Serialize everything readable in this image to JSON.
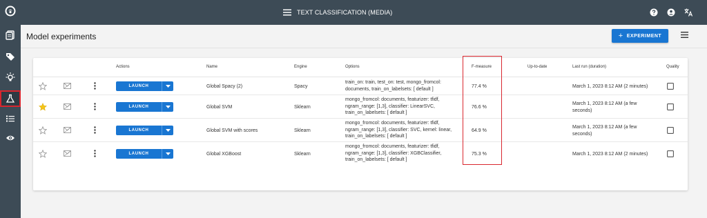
{
  "app": {
    "title": "TEXT CLASSIFICATION (MEDIA)",
    "colors": {
      "chrome": "#3d4b56",
      "accent": "#1976d2",
      "highlight": "#d9262e",
      "star": "#f5c518"
    }
  },
  "page": {
    "title": "Model experiments",
    "experiment_button": "EXPERIMENT"
  },
  "table": {
    "headers": {
      "actions": "Actions",
      "name": "Name",
      "engine": "Engine",
      "options": "Options",
      "fmeasure": "F-measure",
      "uptodate": "Up-to-date",
      "lastrun": "Last run (duration)",
      "quality": "Quality"
    },
    "launch_label": "LAUNCH",
    "rows": [
      {
        "starred": false,
        "name": "Global Spacy (2)",
        "engine": "Spacy",
        "options": [
          "train_on: train, test_on: test, mongo_fromcol:",
          "documents, train_on_labelsets: [ default ]"
        ],
        "fmeasure": "77.4 %",
        "uptodate": "",
        "lastrun": [
          "March 1, 2023 8:12 AM (2 minutes)"
        ]
      },
      {
        "starred": true,
        "name": "Global SVM",
        "engine": "Sklearn",
        "options": [
          "mongo_fromcol: documents, featurizer: tfidf,",
          "ngram_range: [1,3], classifier: LinearSVC,",
          "train_on_labelsets: [ default ]"
        ],
        "fmeasure": "76.6 %",
        "uptodate": "",
        "lastrun": [
          "March 1, 2023 8:12 AM (a few",
          "seconds)"
        ]
      },
      {
        "starred": false,
        "name": "Global SVM with scores",
        "engine": "Sklearn",
        "options": [
          "mongo_fromcol: documents, featurizer: tfidf,",
          "ngram_range: [1,3], classifier: SVC, kernel: linear,",
          "train_on_labelsets: [ default ]"
        ],
        "fmeasure": "64.9 %",
        "uptodate": "",
        "lastrun": [
          "March 1, 2023 8:12 AM (a few",
          "seconds)"
        ]
      },
      {
        "starred": false,
        "name": "Global XGBoost",
        "engine": "Sklearn",
        "options": [
          "mongo_fromcol: documents, featurizer: tfidf,",
          "ngram_range: [1,3], classifier: XGBClassifier,",
          "train_on_labelsets: [ default ]"
        ],
        "fmeasure": "75.3 %",
        "uptodate": "",
        "lastrun": [
          "March 1, 2023 8:12 AM (2 minutes)"
        ]
      }
    ]
  },
  "sidebar": {
    "items": [
      {
        "icon": "logo-icon"
      },
      {
        "icon": "documents-icon"
      },
      {
        "icon": "tag-icon"
      },
      {
        "icon": "lightbulb-icon"
      },
      {
        "icon": "flask-icon",
        "active": true
      },
      {
        "icon": "list-icon"
      },
      {
        "icon": "eye-icon"
      }
    ]
  }
}
